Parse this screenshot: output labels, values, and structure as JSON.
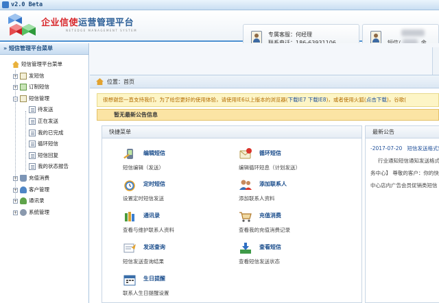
{
  "window": {
    "title": "v2.0 Beta"
  },
  "header": {
    "brand_red": "企业信使",
    "brand_blue": "运营管理平台",
    "brand_sub": "NETEDGE MANAGEMENT SYSTEM",
    "service_label": "专属客服：何经理",
    "service_phone": "联系电话：186-63931106",
    "user_label": "短信/",
    "user_suffix": "余"
  },
  "sidebar": {
    "title": "» 短信管理平台菜单",
    "root": "短信管理平台菜单",
    "items": [
      {
        "label": "发短信",
        "expander": "+"
      },
      {
        "label": "订制短信",
        "expander": "+"
      },
      {
        "label": "短信管理",
        "expander": "−"
      },
      {
        "label": "待发送"
      },
      {
        "label": "正在发送"
      },
      {
        "label": "我的已完成"
      },
      {
        "label": "循环短信"
      },
      {
        "label": "短信回复"
      },
      {
        "label": "我的状态报告"
      },
      {
        "label": "充值消费",
        "expander": "+"
      },
      {
        "label": "客户管理",
        "expander": "+"
      },
      {
        "label": "通讯录",
        "expander": "+"
      },
      {
        "label": "系统管理",
        "expander": "+"
      }
    ]
  },
  "breadcrumb": "位置：首页",
  "notice": {
    "text": "很想谢您一直支持我们，为了给您更好的使用体验，请使用IE6以上版本的浏览器(",
    "links": "下载IE7 下载IE8",
    "text2": ")，或者使用火狐(",
    "link2": "点击下载",
    "text3": ")，谷歌("
  },
  "announcement_bar": "暂无最新公告信息",
  "quick_menu": {
    "title": "快捷菜单",
    "items": [
      {
        "title": "编辑短信",
        "desc": "短信编辑（发送）",
        "icon": "phone-edit-icon"
      },
      {
        "title": "循环短信",
        "desc": "编辑循环短息（计划发送）",
        "icon": "cycle-message-icon"
      },
      {
        "title": "定时短信",
        "desc": "设置定时短信发送",
        "icon": "alarm-clock-icon"
      },
      {
        "title": "添加联系人",
        "desc": "添加联系人资料",
        "icon": "add-contact-icon"
      },
      {
        "title": "通讯录",
        "desc": "查看与维护联系人资料",
        "icon": "address-book-icon"
      },
      {
        "title": "充值消费",
        "desc": "查看我的充值消费记录",
        "icon": "shopping-cart-icon"
      },
      {
        "title": "发送查询",
        "desc": "短信发送查询结果",
        "icon": "send-query-icon"
      },
      {
        "title": "查看短信",
        "desc": "查看短信发送状态",
        "icon": "download-tray-icon"
      },
      {
        "title": "生日提醒",
        "desc": "联系人生日提醒设置",
        "icon": "calendar-icon"
      }
    ]
  },
  "latest_news": {
    "title": "最新公告",
    "date": "-2017-07-20",
    "headline": "短信发送格式要",
    "lines": [
      "行业通知短信通知发送格式为",
      "务中心】 尊敬的客户：你的快递",
      "中心店内广告会员促销类短信"
    ]
  },
  "colors": {
    "accent": "#4b8fd1",
    "brand_red": "#d8262a",
    "brand_blue": "#2c5f97",
    "notice_bg": "#fdf5c6",
    "announce_bg": "#fbe4a4"
  }
}
